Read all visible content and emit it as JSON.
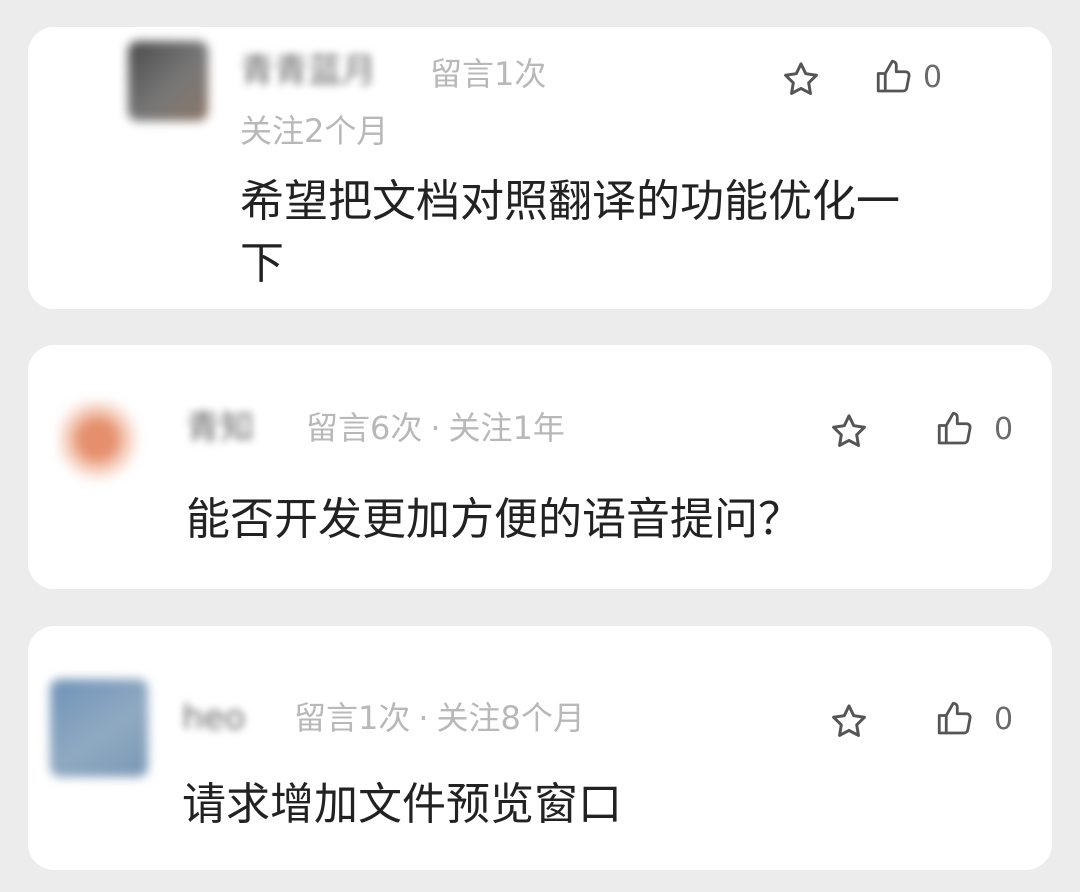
{
  "comments": [
    {
      "user": "青青蓝月",
      "messages": "留言1次",
      "follow": "关注2个月",
      "text_line1": "希望把文档对照翻译的功能优化一",
      "text_line2": "下",
      "likes": "0",
      "avatar_color": "#5a5a5a"
    },
    {
      "user": "青知",
      "messages": "留言6次",
      "separator": "·",
      "follow": "关注1年",
      "text": "能否开发更加方便的语音提问？",
      "likes": "0",
      "avatar_color": "#e59576"
    },
    {
      "user": "heo",
      "messages": "留言1次",
      "separator": "·",
      "follow": "关注8个月",
      "text": "请求增加文件预览窗口",
      "likes": "0",
      "avatar_color": "#7e9fc0"
    }
  ],
  "icons": {
    "favorite": "star-icon",
    "like": "thumbs-up-icon"
  }
}
